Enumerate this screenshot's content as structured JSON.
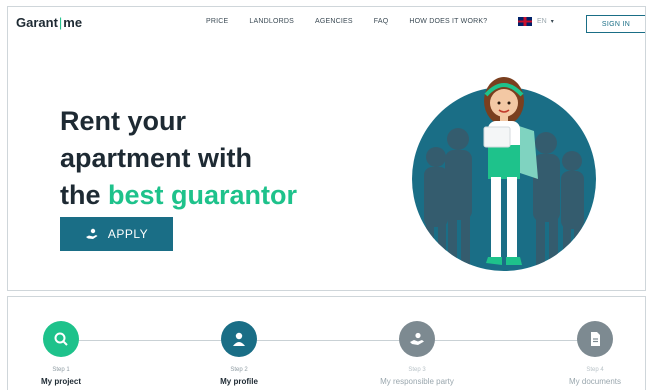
{
  "brand": {
    "name_left": "Garant",
    "separator": "|",
    "name_right": "me"
  },
  "nav": {
    "items": [
      "PRICE",
      "LANDLORDS",
      "AGENCIES",
      "FAQ",
      "HOW DOES IT WORK?"
    ],
    "language": "EN",
    "sign_in": "SIGN IN"
  },
  "hero": {
    "title_line1": "Rent your",
    "title_line2": "apartment with",
    "title_line3_prefix": "the",
    "title_line3_accent": "best guarantor",
    "apply_label": "APPLY"
  },
  "steps": [
    {
      "step": "Step 1",
      "label": "My project",
      "icon": "search-icon",
      "color": "#1ec28b",
      "state": "done"
    },
    {
      "step": "Step 2",
      "label": "My profile",
      "icon": "user-icon",
      "color": "#1a6e86",
      "state": "active"
    },
    {
      "step": "Step 3",
      "label": "My responsible party",
      "icon": "guarantor-icon",
      "color": "#7d8a91",
      "state": "pending"
    },
    {
      "step": "Step 4",
      "label": "My documents",
      "icon": "document-icon",
      "color": "#7d8a91",
      "state": "pending"
    }
  ],
  "colors": {
    "primary": "#1a6e86",
    "accent": "#1ec28b",
    "muted": "#7d8a91",
    "text": "#1e2a33"
  }
}
